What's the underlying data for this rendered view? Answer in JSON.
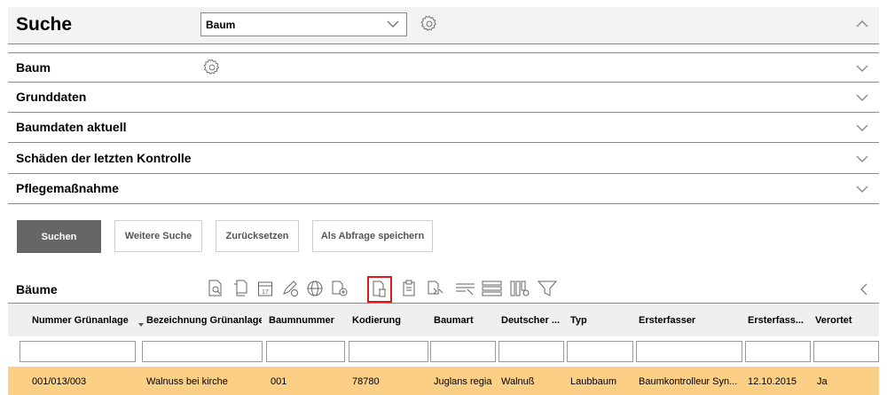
{
  "search": {
    "title": "Suche",
    "select_value": "Baum"
  },
  "sections": [
    {
      "label": "Baum"
    },
    {
      "label": "Grunddaten"
    },
    {
      "label": "Baumdaten aktuell"
    },
    {
      "label": "Schäden der letzten Kontrolle"
    },
    {
      "label": "Pflegemaßnahme"
    }
  ],
  "buttons": {
    "search": "Suchen",
    "more_search": "Weitere Suche",
    "reset": "Zurücksetzen",
    "save_query": "Als Abfrage speichern"
  },
  "table": {
    "title": "Bäume",
    "columns": [
      "Nummer Grünanlage",
      "Bezeichnung Grünanlage",
      "Baumnummer",
      "Kodierung",
      "Baumart",
      "Deutscher ...",
      "Typ",
      "Ersterfasser",
      "Ersterfass...",
      "Verortet"
    ],
    "rows": [
      [
        "001/013/003",
        "Walnuss bei kirche",
        "001",
        "78780",
        "Juglans regia",
        "Walnuß",
        "Laubbaum",
        "Baumkontrolleur Syn...",
        "12.10.2015",
        "Ja"
      ]
    ]
  },
  "colors": {
    "selected_row": "#fbcf86",
    "primary_button": "#666666",
    "highlight_outline": "#e0191b"
  },
  "icons": {
    "toolbar": [
      "view-document-icon",
      "copy-document-icon",
      "calendar-icon",
      "edit-pencil-icon",
      "globe-icon",
      "add-document-icon",
      "delete-document-icon",
      "clipboard-icon",
      "export-document-icon",
      "select-rows-icon",
      "list-icon",
      "columns-settings-icon",
      "filter-icon"
    ]
  }
}
